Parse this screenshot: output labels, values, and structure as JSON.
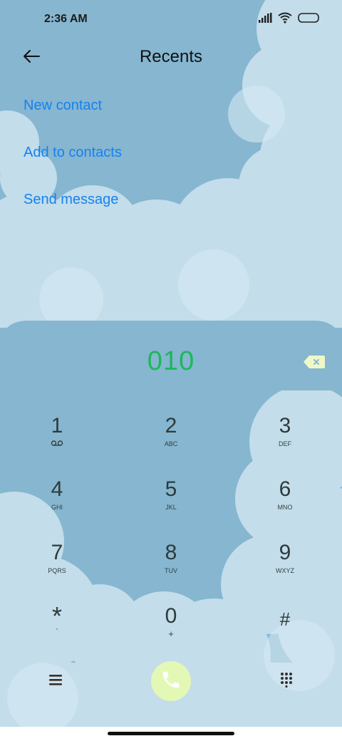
{
  "status_bar": {
    "time": "2:36 AM",
    "icons": [
      "signal-icon",
      "wifi-icon",
      "battery-icon"
    ]
  },
  "header": {
    "back_icon": "arrow-left-icon",
    "title": "Recents"
  },
  "actions": [
    {
      "label": "New contact"
    },
    {
      "label": "Add to contacts"
    },
    {
      "label": "Send message"
    }
  ],
  "dialer": {
    "number": "010",
    "backspace_icon": "backspace-icon",
    "keys": [
      {
        "digit": "1",
        "sub": "",
        "sub_icon": "voicemail-icon"
      },
      {
        "digit": "2",
        "sub": "ABC"
      },
      {
        "digit": "3",
        "sub": "DEF"
      },
      {
        "digit": "4",
        "sub": "GHI"
      },
      {
        "digit": "5",
        "sub": "JKL"
      },
      {
        "digit": "6",
        "sub": "MNO"
      },
      {
        "digit": "7",
        "sub": "PQRS"
      },
      {
        "digit": "8",
        "sub": "TUV"
      },
      {
        "digit": "9",
        "sub": "WXYZ"
      },
      {
        "digit": "*",
        "sub": ","
      },
      {
        "digit": "0",
        "sub": "+"
      },
      {
        "digit": "#",
        "sub": ""
      }
    ]
  },
  "bottom_bar": {
    "menu_icon": "menu-icon",
    "call_icon": "phone-icon",
    "keypad_icon": "keypad-grid-icon"
  },
  "colors": {
    "accent_link": "#1681f2",
    "dialed_number": "#1bb85a",
    "call_button": "#e4f8b6",
    "background": "#86b6d0",
    "cloud": "#c6e0ec"
  }
}
